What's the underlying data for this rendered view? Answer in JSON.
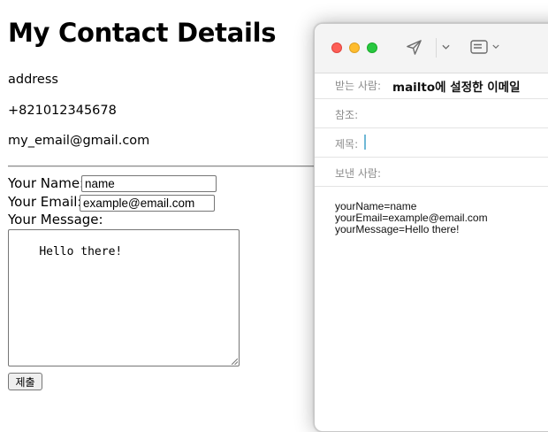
{
  "page": {
    "title": "My Contact Details",
    "address": "address",
    "phone": "+821012345678",
    "email": "my_email@gmail.com",
    "form": {
      "name_label": "Your Name:",
      "name_value": "name",
      "email_label": "Your Email:",
      "email_value": "example@email.com",
      "message_label": "Your Message:",
      "message_value": "Hello there!",
      "submit_label": "제출"
    }
  },
  "mail": {
    "toolbar": {
      "icons": [
        "send-icon",
        "chevron-down-icon",
        "header-fields-icon",
        "chevron-down-icon"
      ]
    },
    "fields": {
      "to_label": "받는 사람:",
      "to_value": "mailto에 설정한 이메일",
      "cc_label": "참조:",
      "subject_label": "제목:",
      "from_label": "보낸 사람:"
    },
    "body": {
      "line1": "yourName=name",
      "line2": "yourEmail=example@email.com",
      "line3": "yourMessage=Hello there!"
    },
    "colors": {
      "close": "#fe5f57",
      "minimize": "#febc2e",
      "maximize": "#28c840",
      "caret": "#6fb8d6"
    }
  }
}
